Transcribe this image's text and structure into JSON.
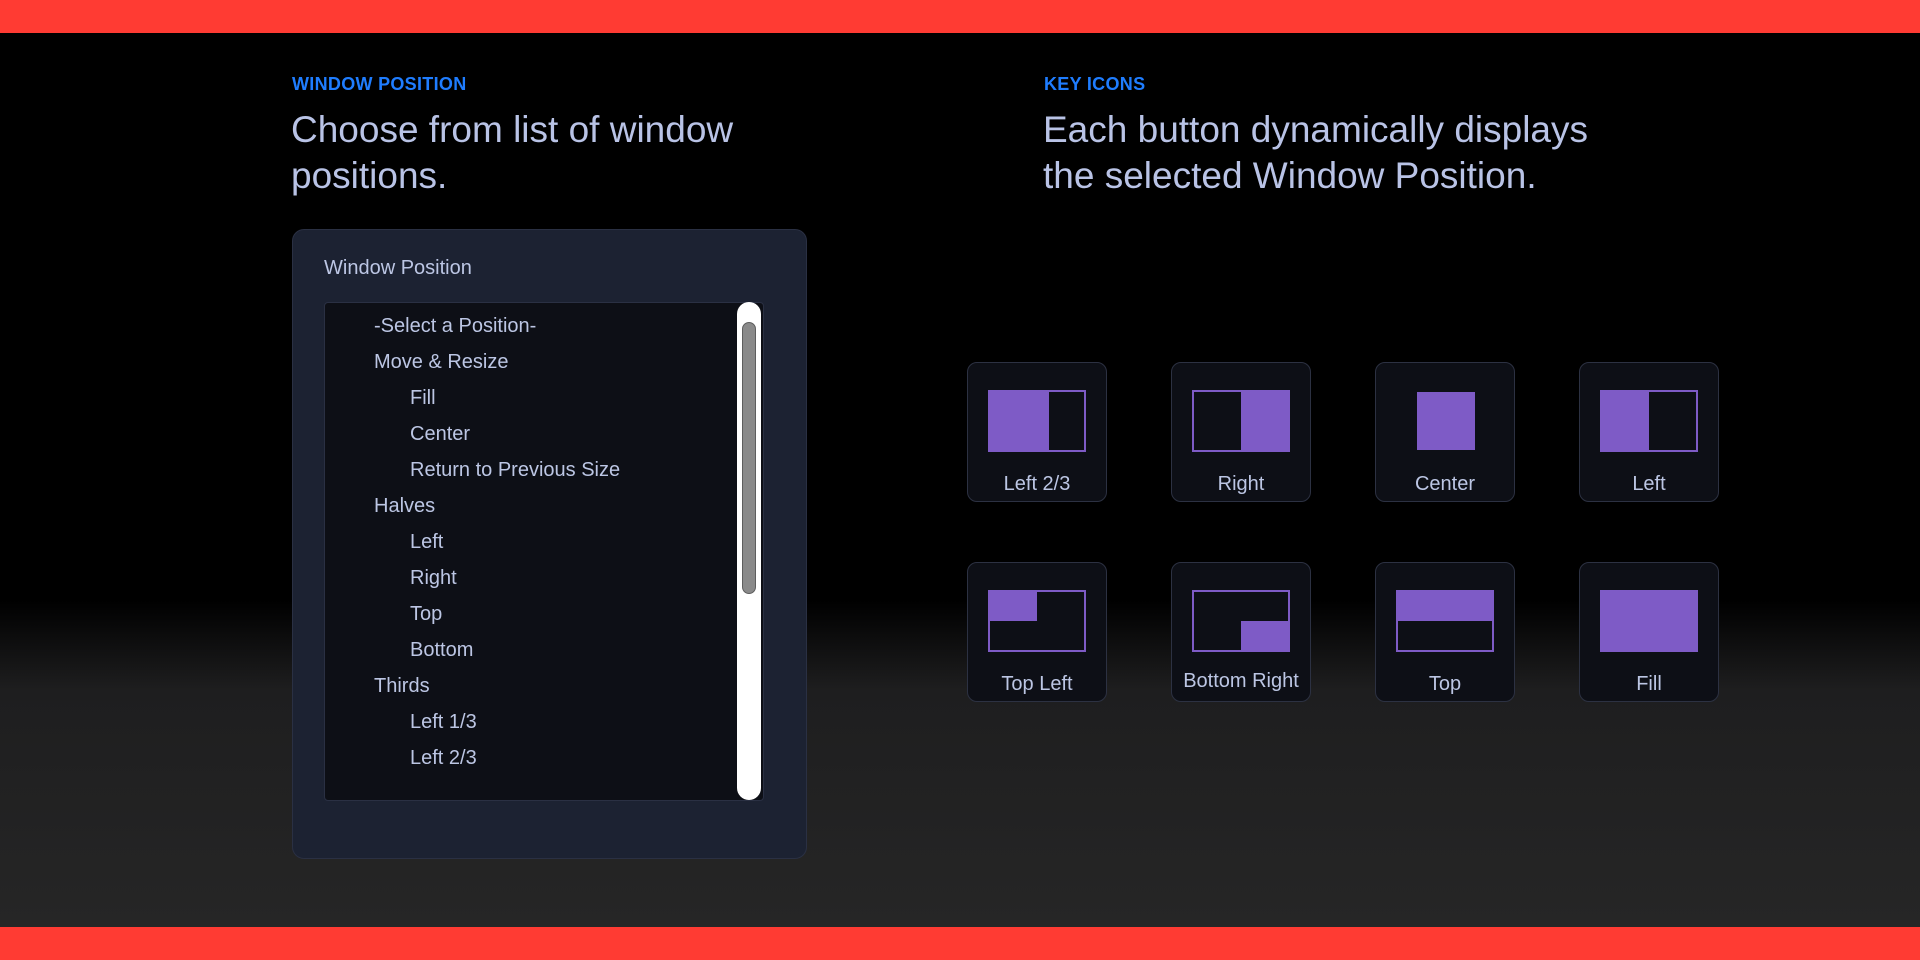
{
  "section_left": {
    "eyebrow": "WINDOW POSITION",
    "headline_line1": "Choose from list of window",
    "headline_line2": "positions."
  },
  "section_right": {
    "eyebrow": "KEY ICONS",
    "headline_line1": "Each button dynamically displays",
    "headline_line2": "the selected Window Position."
  },
  "window_position_panel": {
    "label": "Window Position",
    "options": [
      {
        "text": "-Select a Position-"
      },
      {
        "text": "Move & Resize"
      },
      {
        "text": "Fill"
      },
      {
        "text": "Center"
      },
      {
        "text": "Return to Previous Size"
      },
      {
        "text": "Halves"
      },
      {
        "text": "Left"
      },
      {
        "text": "Right"
      },
      {
        "text": "Top"
      },
      {
        "text": "Bottom"
      },
      {
        "text": "Thirds"
      },
      {
        "text": "Left 1/3"
      },
      {
        "text": "Left 2/3"
      }
    ]
  },
  "key_buttons": [
    {
      "label": "Left 2/3"
    },
    {
      "label": "Right"
    },
    {
      "label": "Center"
    },
    {
      "label": "Left"
    },
    {
      "label": "Top Left"
    },
    {
      "label": "Bottom Right"
    },
    {
      "label": "Top"
    },
    {
      "label": "Fill"
    }
  ],
  "colors": {
    "accent_red": "#ff3b33",
    "eyebrow_blue": "#1f7dff",
    "icon_purple": "#7e5bc6",
    "text": "#bcc6e4"
  }
}
